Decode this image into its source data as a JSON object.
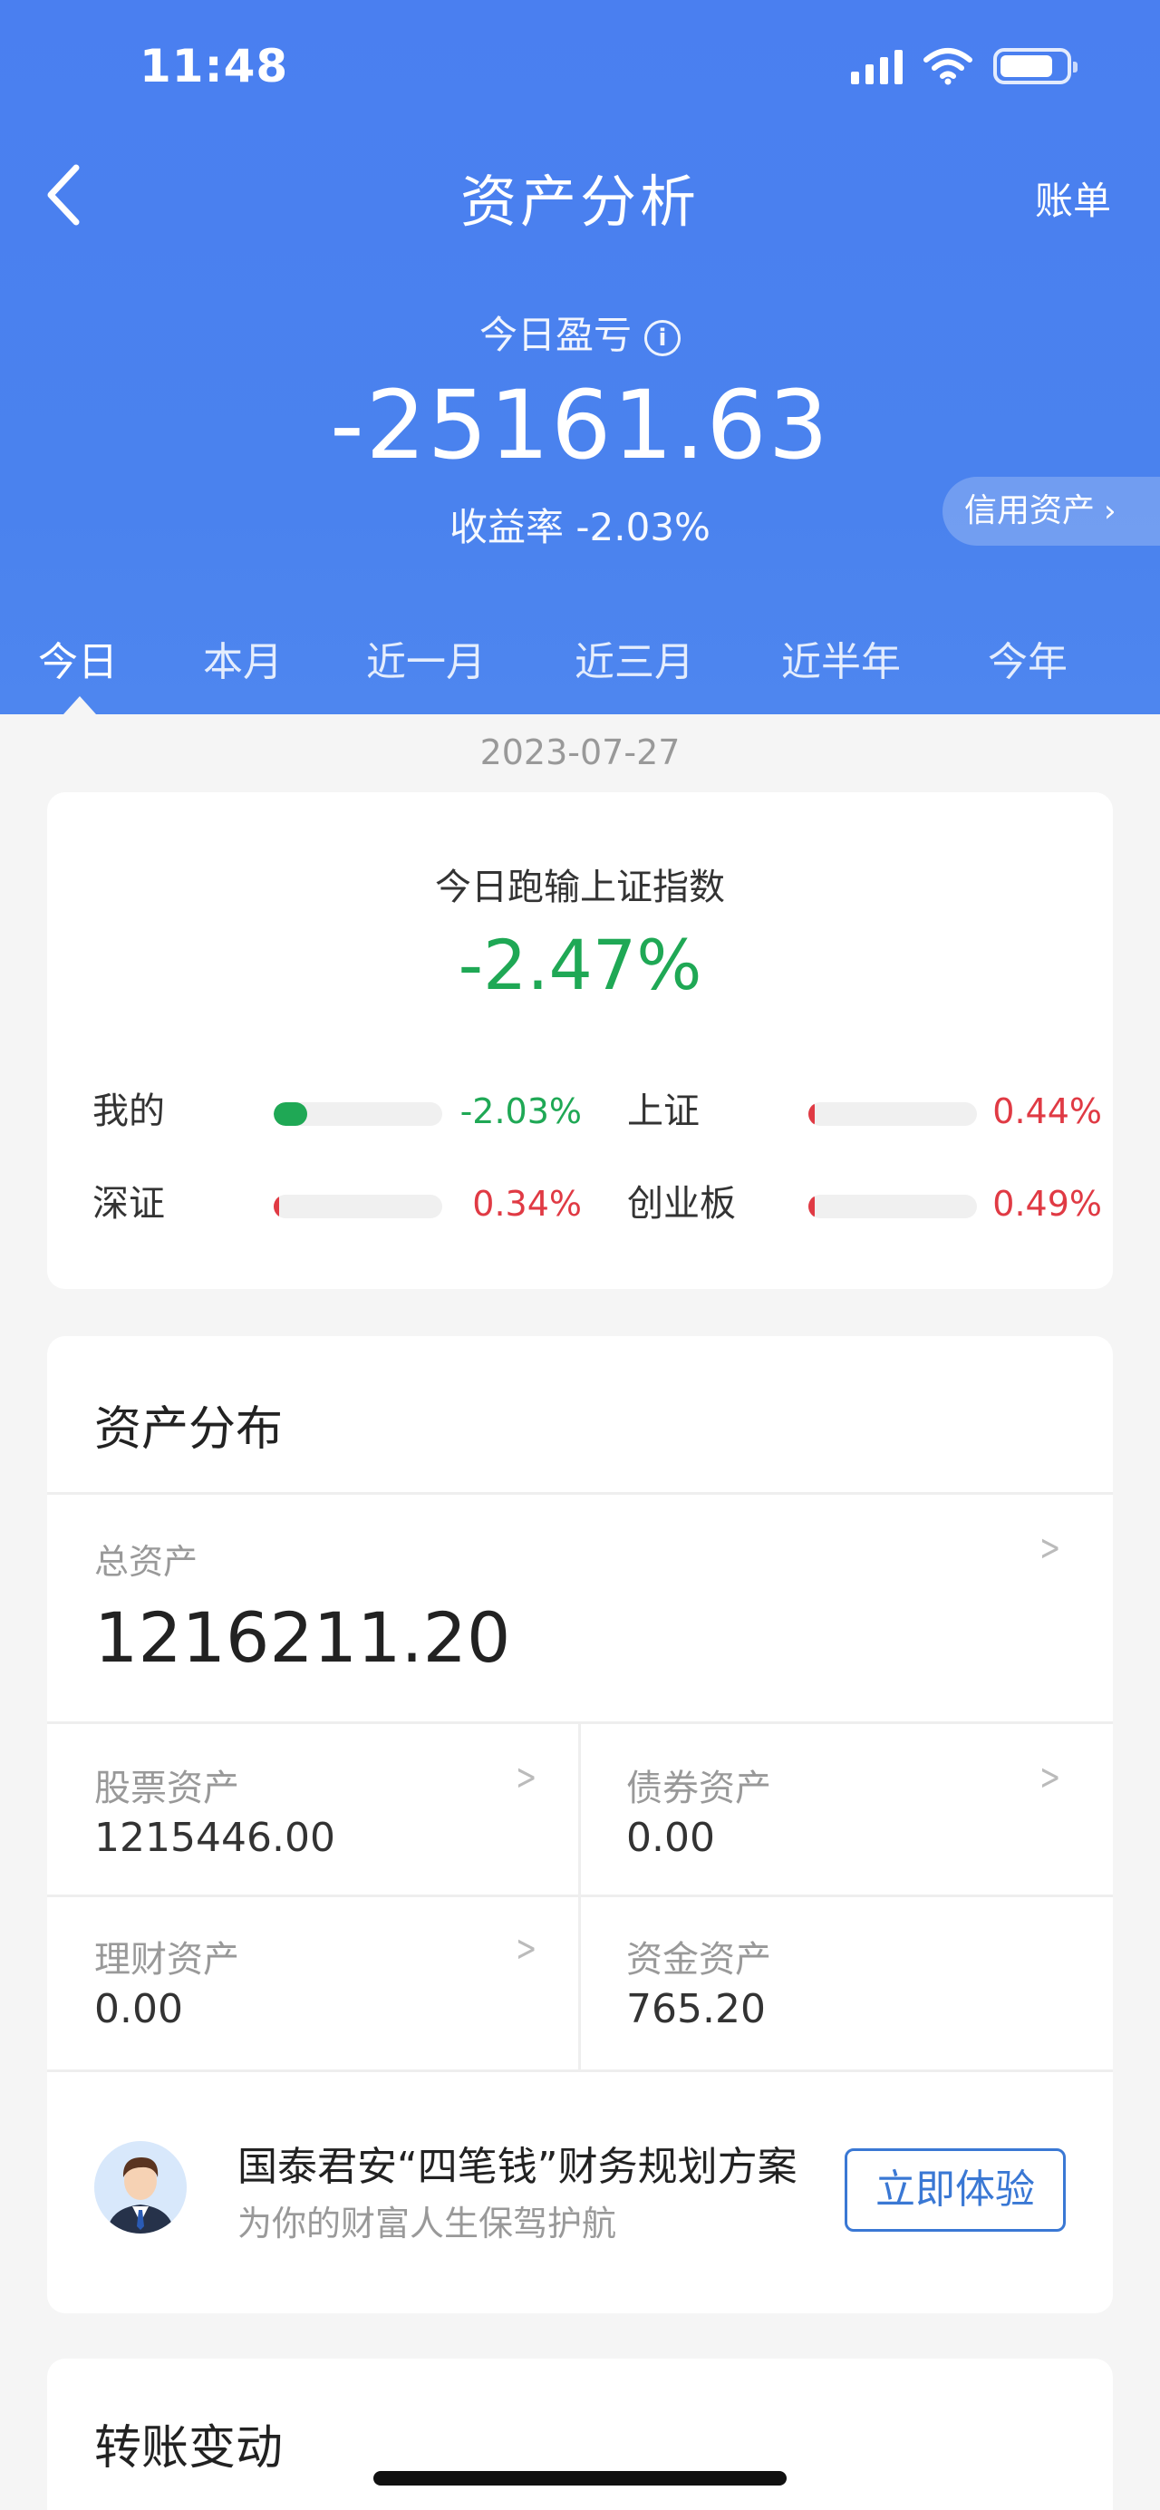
{
  "status_bar": {
    "time": "11:48"
  },
  "header": {
    "title": "资产分析",
    "bill_label": "账单",
    "pnl_label": "今日盈亏",
    "pnl_value": "-25161.63",
    "yield_rate": "收益率 -2.03%",
    "credit_label": "信用资产"
  },
  "tabs": [
    {
      "label": "今日",
      "active": true
    },
    {
      "label": "本月"
    },
    {
      "label": "近一月"
    },
    {
      "label": "近三月"
    },
    {
      "label": "近半年"
    },
    {
      "label": "今年"
    }
  ],
  "date": "2023-07-27",
  "compare": {
    "title": "今日跑输上证指数",
    "value": "-2.47%",
    "rows": [
      {
        "label": "我的",
        "value": "-2.03%",
        "fill": 0.2,
        "color": "#1fa855"
      },
      {
        "label": "上证",
        "value": "0.44%",
        "fill": 0.04,
        "color": "#e03a44"
      },
      {
        "label": "深证",
        "value": "0.34%",
        "fill": 0.03,
        "color": "#e03a44"
      },
      {
        "label": "创业板",
        "value": "0.49%",
        "fill": 0.04,
        "color": "#e03a44"
      }
    ]
  },
  "assets": {
    "title": "资产分布",
    "total_label": "总资产",
    "total_value": "1216211.20",
    "stock_label": "股票资产",
    "stock_value": "1215446.00",
    "bond_label": "债券资产",
    "bond_value": "0.00",
    "wealth_label": "理财资产",
    "wealth_value": "0.00",
    "cash_label": "资金资产",
    "cash_value": "765.20"
  },
  "promo": {
    "title": "国泰君安“四笔钱”财务规划方案",
    "subtitle": "为你的财富人生保驾护航",
    "button": "立即体验"
  },
  "transfer": {
    "title": "转账变动"
  },
  "colors": {
    "primary": "#4a7ff0",
    "green": "#1fa855",
    "red": "#e03a44",
    "link": "#3a78d4"
  }
}
